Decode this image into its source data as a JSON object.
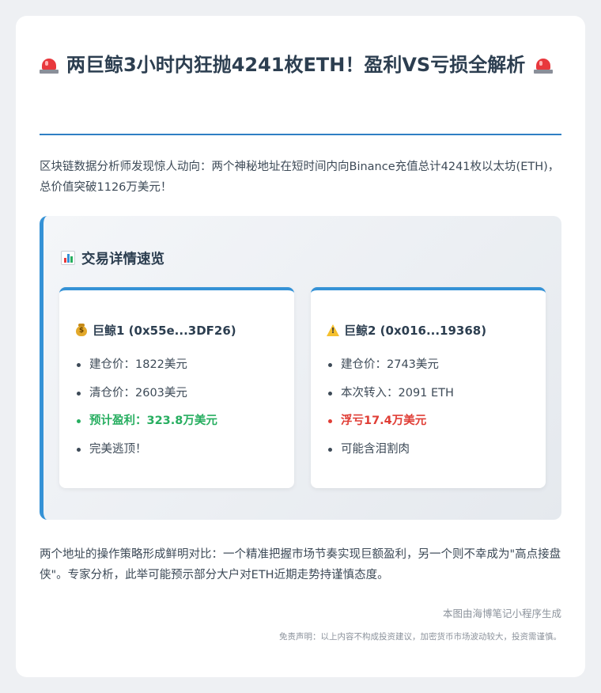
{
  "article": {
    "title": "两巨鲸3小时内狂抛4241枚ETH！盈利VS亏损全解析",
    "title_icon": "rotating-light-icon",
    "intro": "区块链数据分析师发现惊人动向：两个神秘地址在短时间内向Binance充值总计4241枚以太坊(ETH)，总价值突破1126万美元！",
    "panel": {
      "title": "交易详情速览",
      "icon": "bar-chart-icon",
      "whales": [
        {
          "icon": "money-bag-icon",
          "title": "巨鲸1 (0x55e...3DF26)",
          "items": [
            {
              "text": "建仓价：1822美元",
              "tone": "normal"
            },
            {
              "text": "清仓价：2603美元",
              "tone": "normal"
            },
            {
              "text": "预计盈利：323.8万美元",
              "tone": "good"
            },
            {
              "text": "完美逃顶！",
              "tone": "normal"
            }
          ]
        },
        {
          "icon": "warning-icon",
          "title": "巨鲸2 (0x016...19368)",
          "items": [
            {
              "text": "建仓价：2743美元",
              "tone": "normal"
            },
            {
              "text": "本次转入：2091 ETH",
              "tone": "normal"
            },
            {
              "text": "浮亏17.4万美元",
              "tone": "bad"
            },
            {
              "text": "可能含泪割肉",
              "tone": "normal"
            }
          ]
        }
      ]
    },
    "conclusion": "两个地址的操作策略形成鲜明对比：一个精准把握市场节奏实现巨额盈利，另一个则不幸成为\"高点接盘侠\"。专家分析，此举可能预示部分大户对ETH近期走势持谨慎态度。",
    "source": "本图由海博笔记小程序生成",
    "disclaimer": "免责声明：以上内容不构成投资建议，加密货币市场波动较大，投资需谨慎。"
  },
  "colors": {
    "accent": "#3592d6",
    "profit": "#27ae60",
    "loss": "#e03e36",
    "text": "#2c3e50"
  }
}
